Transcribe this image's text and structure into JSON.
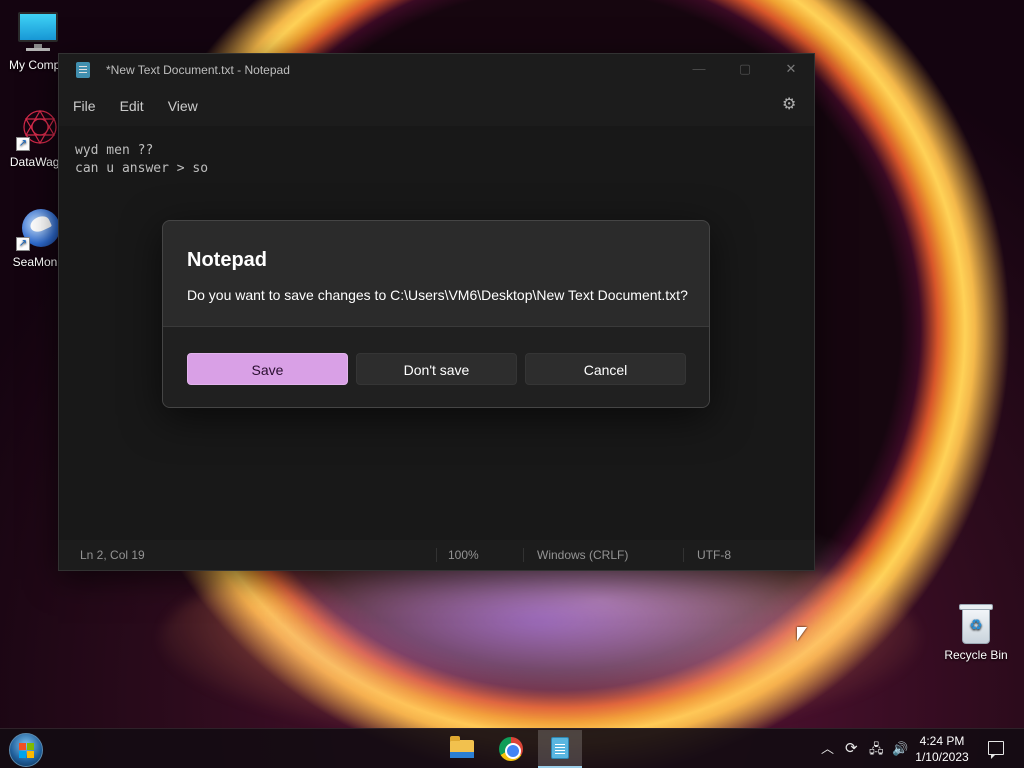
{
  "desktop": {
    "icons": [
      {
        "label": "My Compu"
      },
      {
        "label": "DataWago"
      },
      {
        "label": "SeaMonk"
      }
    ],
    "recycle_bin": {
      "label": "Recycle Bin"
    }
  },
  "notepad": {
    "title": "*New Text Document.txt - Notepad",
    "window_buttons": {
      "minimize": "—",
      "maximize": "▢",
      "close": "✕"
    },
    "menu": [
      "File",
      "Edit",
      "View"
    ],
    "settings_icon": "gear-icon",
    "content_lines": [
      "wyd men ??",
      "can u answer > so"
    ],
    "status": {
      "position": "Ln 2, Col 19",
      "zoom": "100%",
      "line_ending": "Windows (CRLF)",
      "encoding": "UTF-8"
    }
  },
  "dialog": {
    "title": "Notepad",
    "message": "Do you want to save changes to C:\\Users\\VM6\\Desktop\\New Text Document.txt?",
    "buttons": {
      "save": "Save",
      "dont_save": "Don't save",
      "cancel": "Cancel"
    },
    "accent_color": "#d9a0e6"
  },
  "taskbar": {
    "apps": [
      "File Explorer",
      "Google Chrome",
      "Notepad"
    ],
    "active_app": "Notepad",
    "clock": {
      "time": "4:24 PM",
      "date": "1/10/2023"
    }
  }
}
